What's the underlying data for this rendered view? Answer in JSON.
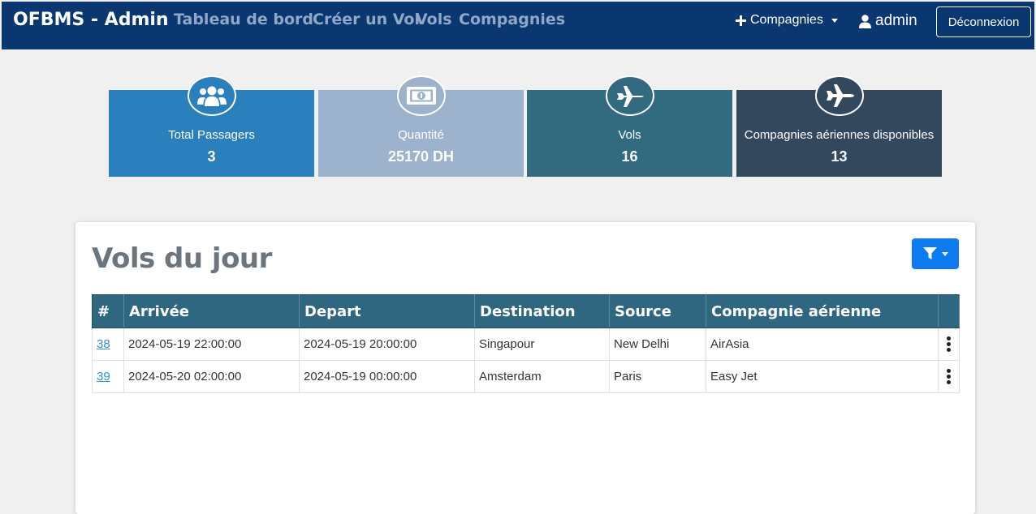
{
  "navbar": {
    "brand": "OFBMS - Admin",
    "links": [
      "Tableau de bord",
      "Créer un Vol",
      "Vols",
      "Compagnies"
    ],
    "add_dropdown_label": "Compagnies",
    "user_label": "admin",
    "logout_label": "Déconnexion",
    "bg_color": "#0a3770"
  },
  "stats": [
    {
      "label": "Total Passagers",
      "value": "3",
      "icon": "users-icon",
      "color": "#2a7fbd"
    },
    {
      "label": "Quantité",
      "value": "25170 DH",
      "icon": "money-bill-icon",
      "color": "#9db2cc"
    },
    {
      "label": "Vols",
      "value": "16",
      "icon": "plane-icon",
      "color": "#326a80"
    },
    {
      "label": "Compagnies aériennes disponibles",
      "value": "13",
      "icon": "plane-arrival-icon",
      "color": "#33475d"
    }
  ],
  "panel": {
    "title": "Vols du jour",
    "filter_icon": "filter-icon"
  },
  "table": {
    "headers": [
      "#",
      "Arrivée",
      "Depart",
      "Destination",
      "Source",
      "Compagnie aérienne",
      ""
    ],
    "rows": [
      {
        "id": "38",
        "arrival": "2024-05-19 22:00:00",
        "departure": "2024-05-19 20:00:00",
        "destination": "Singapour",
        "source": "New Delhi",
        "airline": "AirAsia"
      },
      {
        "id": "39",
        "arrival": "2024-05-20 02:00:00",
        "departure": "2024-05-19 00:00:00",
        "destination": "Amsterdam",
        "source": "Paris",
        "airline": "Easy Jet"
      }
    ],
    "header_color": "#2f6680"
  }
}
